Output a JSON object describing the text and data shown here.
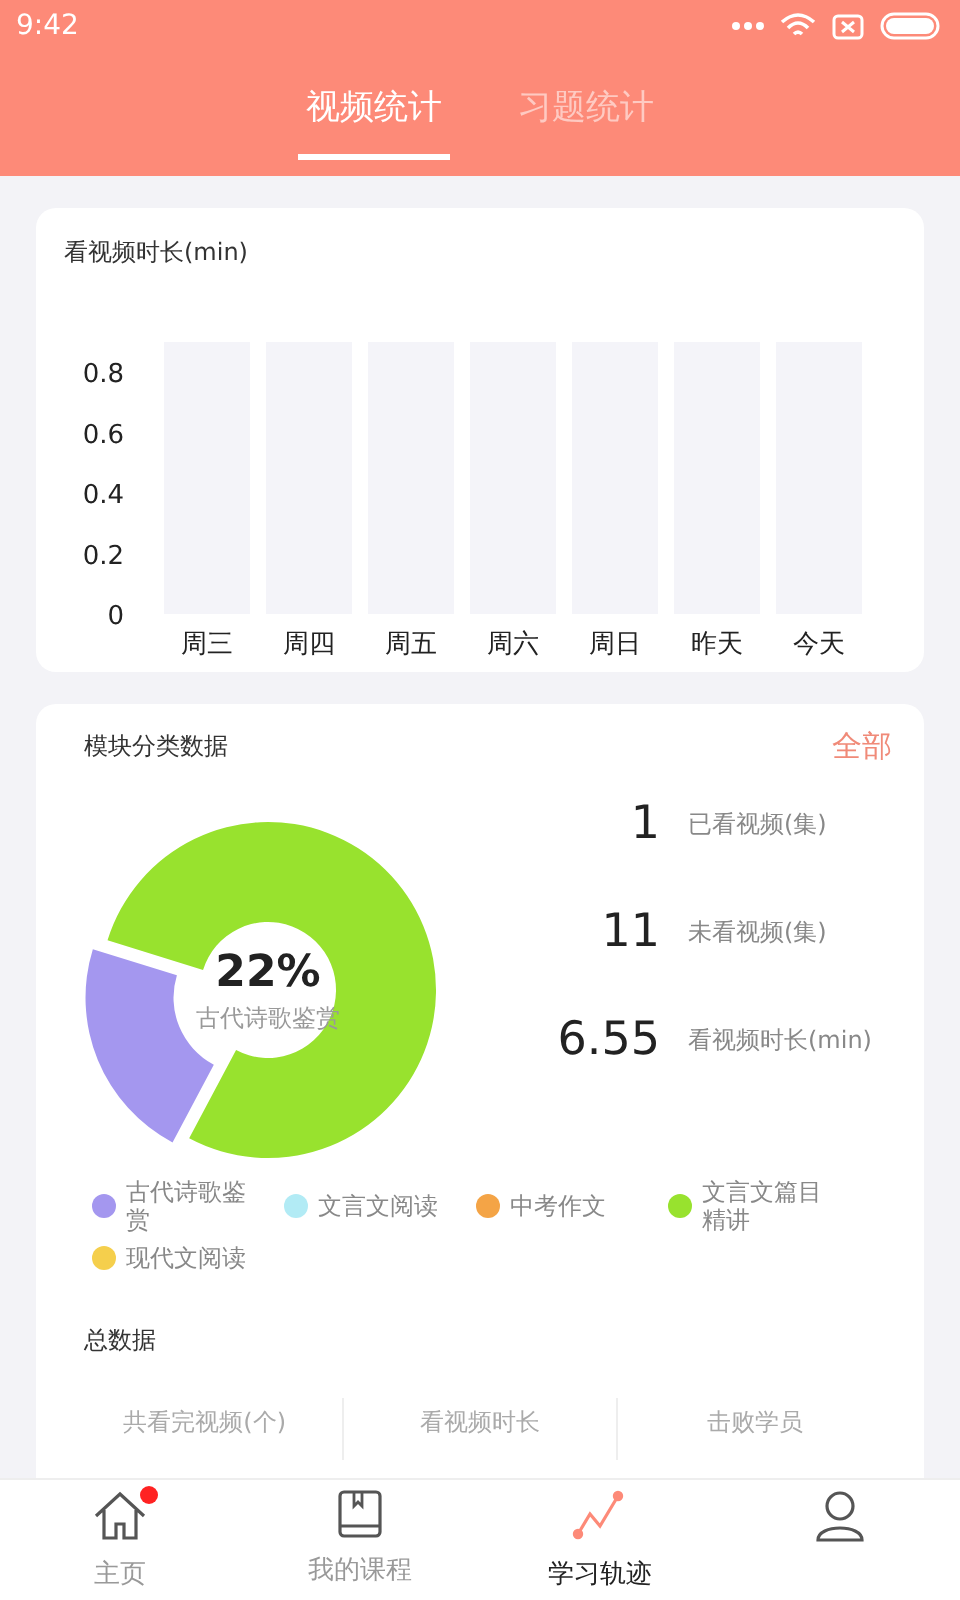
{
  "status_bar": {
    "time": "9:42"
  },
  "tabs": [
    {
      "label": "视频统计",
      "selected": true
    },
    {
      "label": "习题统计",
      "selected": false
    }
  ],
  "watch_time_card": {
    "title": "看视频时长(min)",
    "chart_data": {
      "type": "bar",
      "categories": [
        "周三",
        "周四",
        "周五",
        "周六",
        "周日",
        "昨天",
        "今天"
      ],
      "values": [
        0,
        0,
        0,
        0,
        0,
        0,
        0
      ],
      "ylim": [
        0,
        0.8
      ],
      "yticks": [
        0,
        0.2,
        0.4,
        0.6,
        0.8
      ]
    }
  },
  "module_card": {
    "title": "模块分类数据",
    "all_link": "全部",
    "center_value": "22%",
    "center_label": "古代诗歌鉴赏",
    "stats": [
      {
        "value": "1",
        "label": "已看视频(集)"
      },
      {
        "value": "11",
        "label": "未看视频(集)"
      },
      {
        "value": "6.55",
        "label": "看视频时长(min)"
      }
    ],
    "legend": [
      {
        "label": "古代诗歌鉴赏",
        "color": "#a497ef"
      },
      {
        "label": "文言文阅读",
        "color": "#b2ebf5"
      },
      {
        "label": "中考作文",
        "color": "#f4a446"
      },
      {
        "label": "文言文篇目精讲",
        "color": "#98e22e"
      },
      {
        "label": "现代文阅读",
        "color": "#f5cf4c"
      }
    ]
  },
  "totals": {
    "title": "总数据",
    "columns": [
      "共看完视频(个)",
      "看视频时长",
      "击败学员"
    ]
  },
  "bottom_nav": [
    {
      "kind": "home",
      "label": "主页",
      "selected": false,
      "badge": true
    },
    {
      "kind": "book",
      "label": "我的课程",
      "selected": false,
      "badge": false
    },
    {
      "kind": "trend",
      "label": "学习轨迹",
      "selected": true,
      "badge": false
    },
    {
      "kind": "person",
      "selected": false,
      "badge": false
    }
  ]
}
